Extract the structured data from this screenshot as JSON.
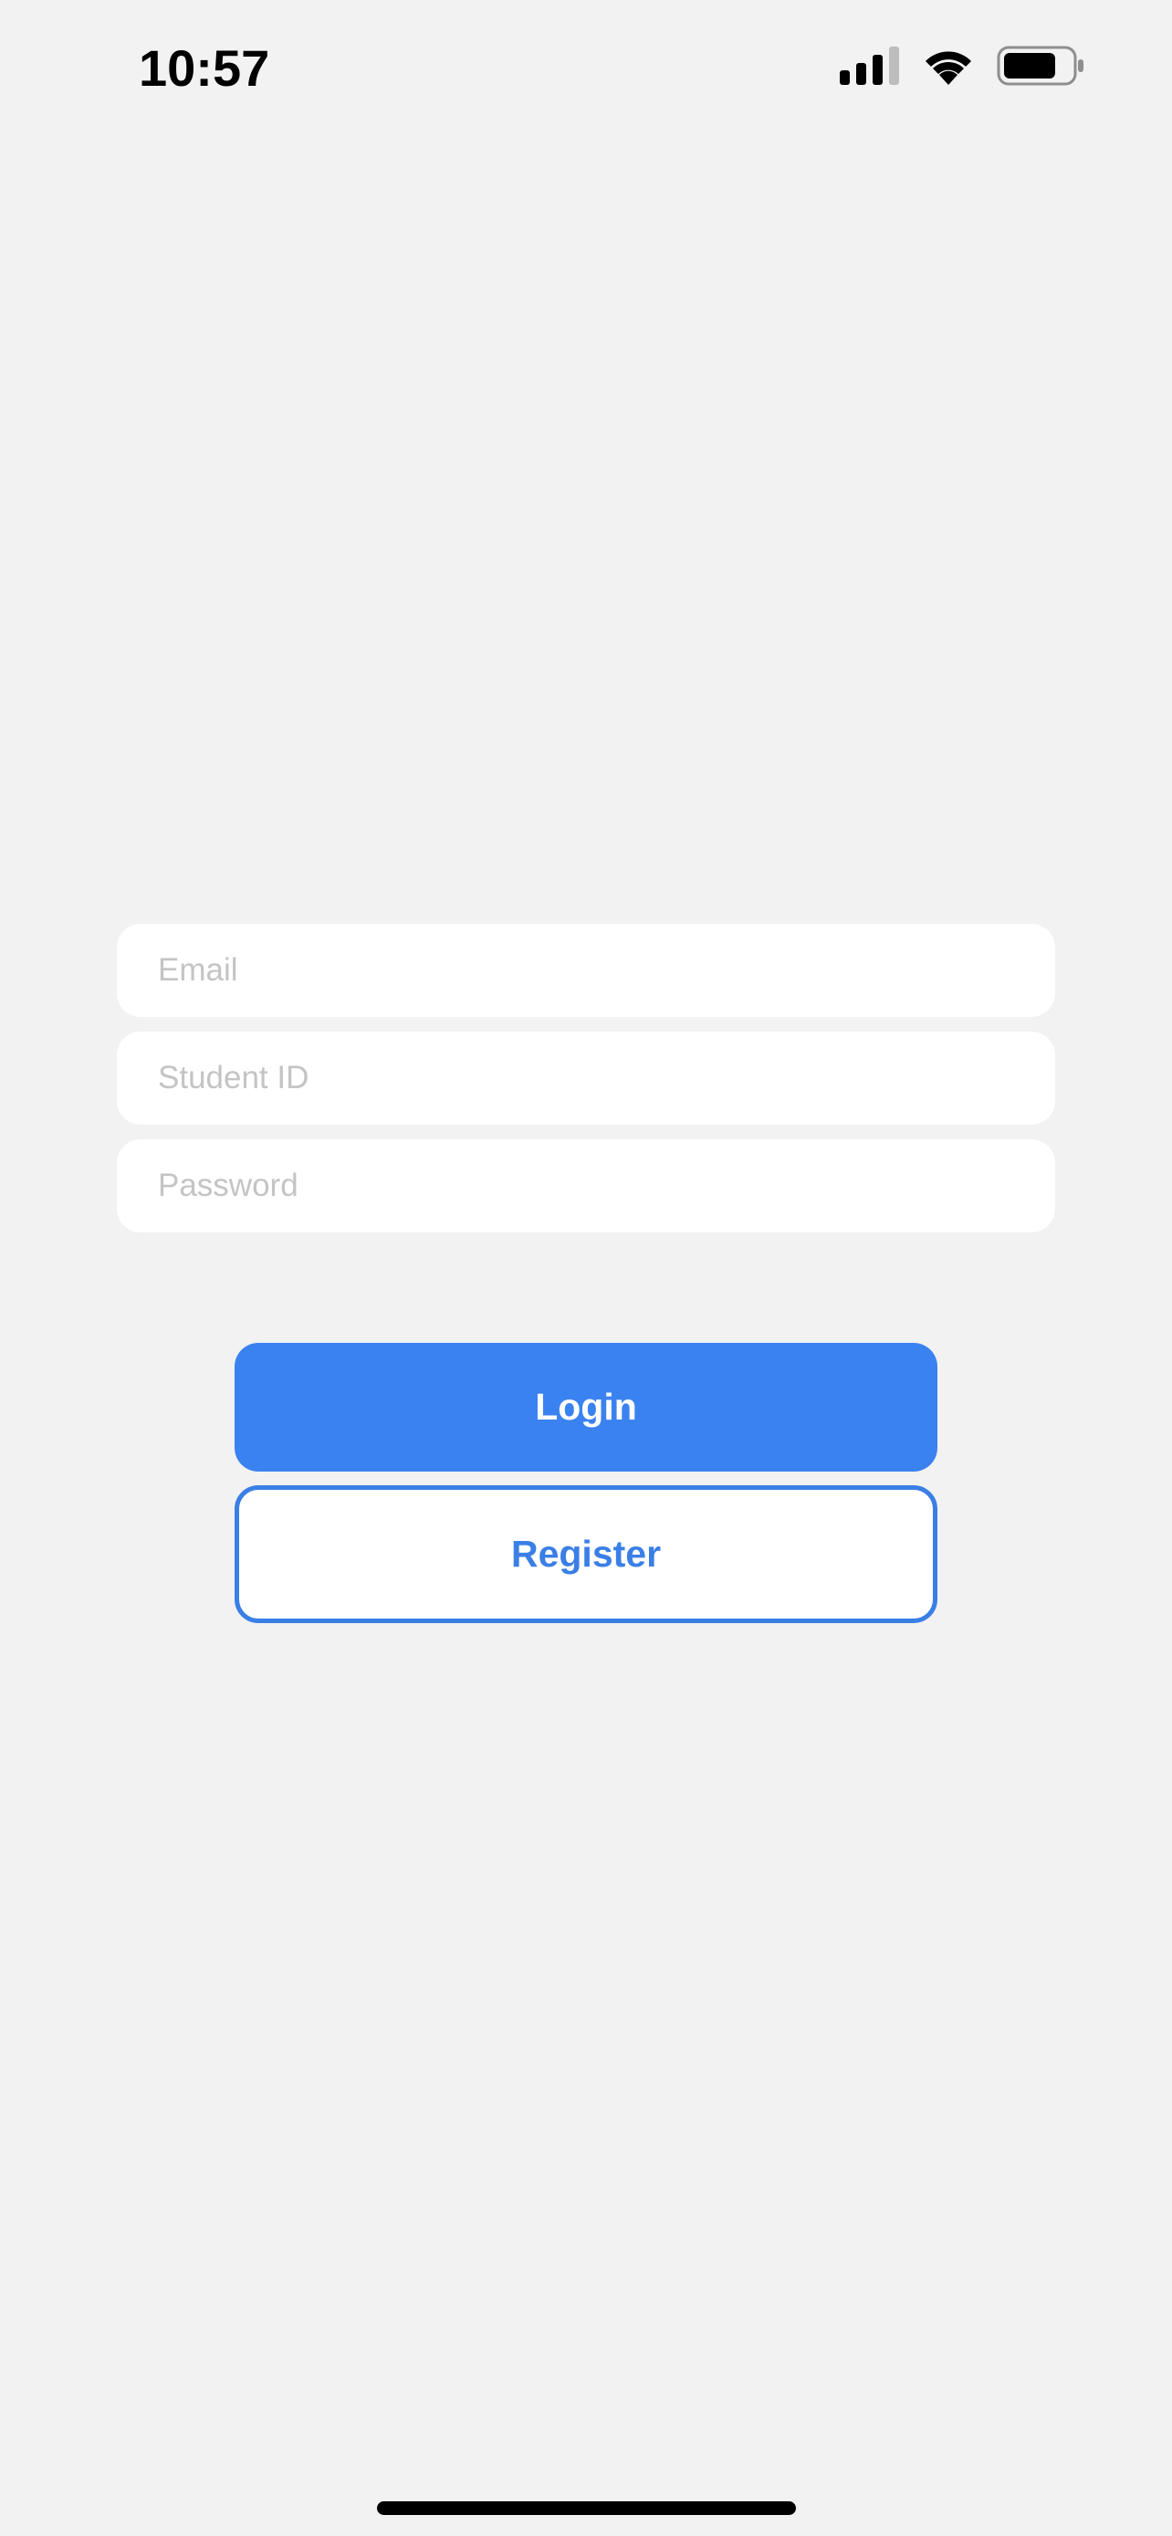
{
  "status_bar": {
    "time": "10:57",
    "signal_icon": "cellular-signal-icon",
    "wifi_icon": "wifi-icon",
    "battery_icon": "battery-icon"
  },
  "form": {
    "email": {
      "placeholder": "Email",
      "value": ""
    },
    "student_id": {
      "placeholder": "Student ID",
      "value": ""
    },
    "password": {
      "placeholder": "Password",
      "value": ""
    }
  },
  "buttons": {
    "login_label": "Login",
    "register_label": "Register"
  },
  "colors": {
    "background": "#f2f2f2",
    "primary": "#3a82f0",
    "placeholder": "#c4c4c6"
  }
}
